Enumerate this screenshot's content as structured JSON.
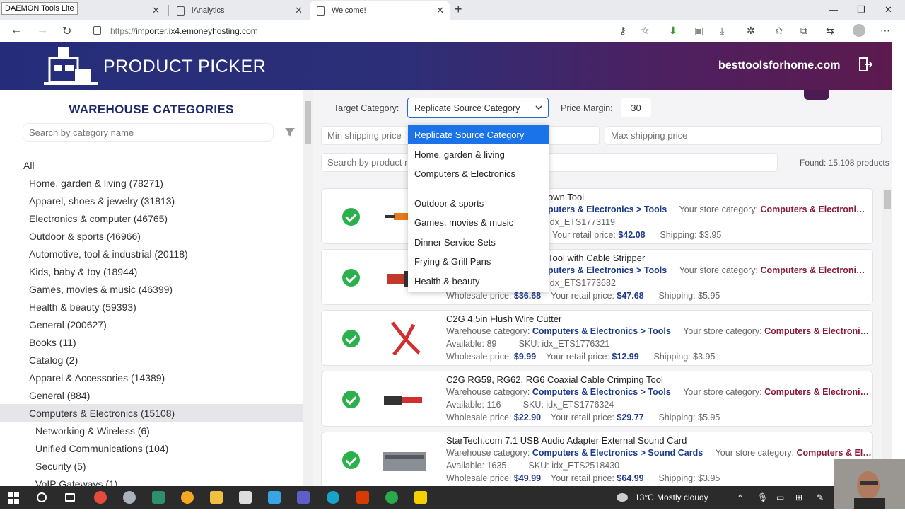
{
  "browser": {
    "tooltip": "DAEMON Tools Lite",
    "tabs": [
      {
        "label": "-"
      },
      {
        "label": "iAnalytics"
      },
      {
        "label": "Welcome!"
      }
    ],
    "url_protocol": "https://",
    "url_host": "importer.ix4.emoneyhosting.com"
  },
  "header": {
    "title": "PRODUCT PICKER",
    "site": "besttoolsforhome.com"
  },
  "sidebar": {
    "title": "WAREHOUSE CATEGORIES",
    "search_placeholder": "Search by category name",
    "categories": [
      {
        "label": "All"
      },
      {
        "label": "Home, garden & living (78271)"
      },
      {
        "label": "Apparel, shoes & jewelry (31813)"
      },
      {
        "label": "Electronics & computer (46765)"
      },
      {
        "label": "Outdoor & sports (46966)"
      },
      {
        "label": "Automotive, tool & industrial (20118)"
      },
      {
        "label": "Kids, baby & toy (18944)"
      },
      {
        "label": "Games, movies & music (46399)"
      },
      {
        "label": "Health & beauty (59393)"
      },
      {
        "label": "General (200627)"
      },
      {
        "label": "Books (11)"
      },
      {
        "label": "Catalog (2)"
      },
      {
        "label": "Apparel & Accessories (14389)"
      },
      {
        "label": "General (884)"
      },
      {
        "label": "Computers & Electronics (15108)"
      },
      {
        "label": "Networking & Wireless (6)"
      },
      {
        "label": "Unified Communications (104)"
      },
      {
        "label": "Security (5)"
      },
      {
        "label": "VoIP Gateways (1)"
      }
    ]
  },
  "filters": {
    "target_label": "Target Category:",
    "target_value": "Replicate Source Category",
    "margin_label": "Price Margin:",
    "margin_value": "30",
    "min_ship_placeholder": "Min shipping price",
    "max_ship_placeholder": "Max shipping price",
    "search_placeholder": "Search by product n",
    "found": "Found: 15,108 products"
  },
  "dropdown": [
    "Replicate Source Category",
    "Home, garden & living",
    "Computers & Electronics",
    "",
    "Outdoor & sports",
    "Games, movies & music",
    "Dinner Service Sets",
    "Frying & Grill Pans",
    "Health & beauty"
  ],
  "labels": {
    "wh_cat": "Warehouse category:",
    "store_cat": "Your store category:",
    "available": "Available:",
    "sku": "SKU:",
    "wholesale": "Wholesale price:",
    "retail": "Your retail price:",
    "shipping": "Shipping:"
  },
  "products": [
    {
      "title": "own Tool",
      "wh": "puters & Electronics > Tools",
      "store": "Computers & Electroni…",
      "avail": "",
      "sku": "idx_ETS1773119",
      "wholesale": "",
      "retail": "$42.08",
      "ship": "$3.95"
    },
    {
      "title": "Tool with Cable Stripper",
      "wh": "puters & Electronics > Tools",
      "store": "Computers & Electroni…",
      "avail": "",
      "sku": "idx_ETS1773682",
      "wholesale": "$36.68",
      "retail": "$47.68",
      "ship": "$5.95"
    },
    {
      "title": "C2G 4.5in Flush Wire Cutter",
      "wh": "Computers & Electronics > Tools",
      "store": "Computers & Electroni…",
      "avail": "89",
      "sku": "idx_ETS1776321",
      "wholesale": "$9.99",
      "retail": "$12.99",
      "ship": "$3.95"
    },
    {
      "title": "C2G RG59, RG62, RG6 Coaxial Cable Crimping Tool",
      "wh": "Computers & Electronics > Tools",
      "store": "Computers & Electroni…",
      "avail": "116",
      "sku": "idx_ETS1776324",
      "wholesale": "$22.90",
      "retail": "$29.77",
      "ship": "$5.95"
    },
    {
      "title": "StarTech.com 7.1 USB Audio Adapter External Sound Card",
      "wh": "Computers & Electronics > Sound Cards",
      "store": "Computers & El…",
      "avail": "1635",
      "sku": "idx_ETS2518430",
      "wholesale": "$49.99",
      "retail": "$64.99",
      "ship": "$3.95"
    }
  ],
  "taskbar": {
    "temp": "13°C",
    "weather": "Mostly cloudy"
  }
}
